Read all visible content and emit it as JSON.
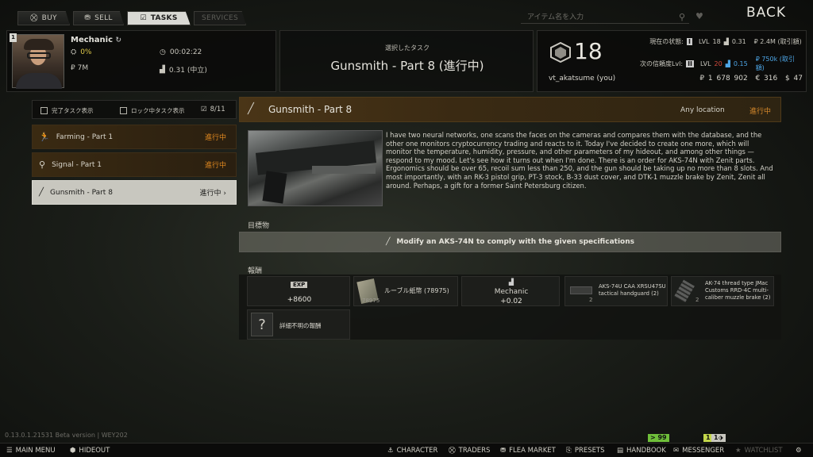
{
  "nav": {
    "tabs": [
      {
        "label": "BUY",
        "icon": "cart-icon"
      },
      {
        "label": "SELL",
        "icon": "sell-icon"
      },
      {
        "label": "TASKS",
        "icon": "tasks-icon"
      },
      {
        "label": "SERVICES",
        "icon": ""
      }
    ],
    "search_placeholder": "アイテム名を入力",
    "back_label": "BACK"
  },
  "trader": {
    "level_badge": "1",
    "name": "Mechanic",
    "loyalty_pct": "0%",
    "timer": "00:02:22",
    "money": "₽ 7M",
    "standing": "0.31 (中立)"
  },
  "selected_task": {
    "caption": "選択したタスク",
    "title": "Gunsmith - Part 8 (進行中)"
  },
  "player": {
    "level": "18",
    "name": "vt_akatsume (you)",
    "current_status_label": "現在の状態:",
    "current_level_badge": "I",
    "current_lvl": "18",
    "current_standing": "0.31",
    "current_money": "₽ 2.4M (取引額)",
    "next_status_label": "次の信頼度Lvl:",
    "next_level_badge": "II",
    "next_lvl": "20",
    "next_standing": "0.15",
    "next_money": "₽ 750k (取引額)",
    "rubles": "₽ 1 678 902",
    "euros": "€ 316",
    "dollars": "$ 47",
    "lvl_prefix": "LVL"
  },
  "filters": {
    "show_completed": "完了タスク表示",
    "show_locked": "ロック中タスク表示",
    "count": "8/11"
  },
  "tasks": [
    {
      "name": "Farming - Part 1",
      "status": "進行中",
      "icon": "runner-icon"
    },
    {
      "name": "Signal - Part 1",
      "status": "進行中",
      "icon": "map-pin-icon"
    },
    {
      "name": "Gunsmith - Part 8",
      "status": "進行中",
      "icon": "rifle-icon"
    }
  ],
  "detail": {
    "title": "Gunsmith - Part 8",
    "location": "Any location",
    "status": "進行中",
    "description": "I have two neural networks, one scans the faces on the cameras and compares them with the database, and the other one monitors cryptocurrency trading and reacts to it. Today I've decided to create one more, which will monitor the temperature, humidity, pressure, and other parameters of my hideout, and among other things — respond to my mood. Let's see how it turns out when I'm done. There is an order for AKS-74N with Zenit parts. Ergonomics should be over 65, recoil sum less than 250, and the gun should be taking up no more than 8 slots. And most importantly, with an RK-3 pistol grip, PT-3 stock, B-33 dust cover, and DTK-1 muzzle brake by Zenit, Zenit all around. Perhaps, a gift for a former Saint Petersburg citizen.",
    "objectives_label": "目標物",
    "objective": "Modify an AKS-74N to comply with the given specifications",
    "rewards_label": "報酬",
    "rewards": {
      "exp_badge": "EXP",
      "exp_value": "+8600",
      "item1_name": "ルーブル紙幣 (78975)",
      "item1_count": "78975",
      "trader_name": "Mechanic",
      "trader_rep": "+0.02",
      "item2_name": "AKS-74U CAA XRSU47SU tactical handguard (2)",
      "item2_count": "2",
      "item3_name": "AK-74 thread type JMac Customs RRD-4C multi-caliber muzzle brake (2)",
      "item3_count": "2",
      "unknown_label": "詳細不明の報酬"
    }
  },
  "footer": {
    "version": "0.13.0.1.21531 Beta version | WEY202",
    "badge_a": "> 99",
    "badge_b": "1",
    "badge_c": "1",
    "buttons": [
      "MAIN MENU",
      "HIDEOUT",
      "CHARACTER",
      "TRADERS",
      "FLEA MARKET",
      "PRESETS",
      "HANDBOOK",
      "MESSENGER",
      "WATCHLIST"
    ]
  },
  "colors": {
    "in_progress": "#e2891f",
    "loyalty_yellow": "#e0c94a",
    "next_blue": "#4ea7e8",
    "next_red": "#d44a3c",
    "selected_row": "#c8c7bf"
  }
}
